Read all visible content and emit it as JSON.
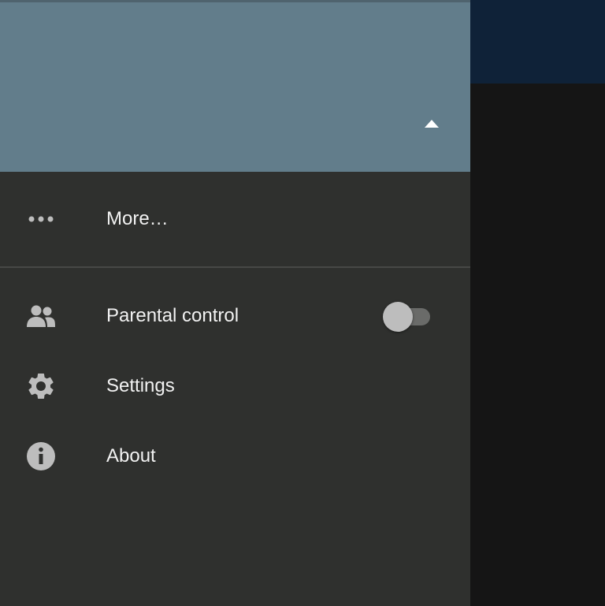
{
  "colors": {
    "drawer_background": "#2f302e",
    "header_background": "#627d8b",
    "app_bar_background": "#0f2238",
    "content_background": "#151515",
    "icon_color": "#bdbdbd",
    "text_color": "#f2f2f2",
    "switch_thumb": "#bdbdbd",
    "switch_track": "#6a6b69"
  },
  "header": {
    "toggle_icon": "triangle-up-icon"
  },
  "menu": {
    "more": {
      "label": "More…",
      "icon": "more-dots-icon"
    },
    "parental_control": {
      "label": "Parental control",
      "icon": "people-icon",
      "switch_on": false
    },
    "settings": {
      "label": "Settings",
      "icon": "gear-icon"
    },
    "about": {
      "label": "About",
      "icon": "info-icon"
    }
  }
}
